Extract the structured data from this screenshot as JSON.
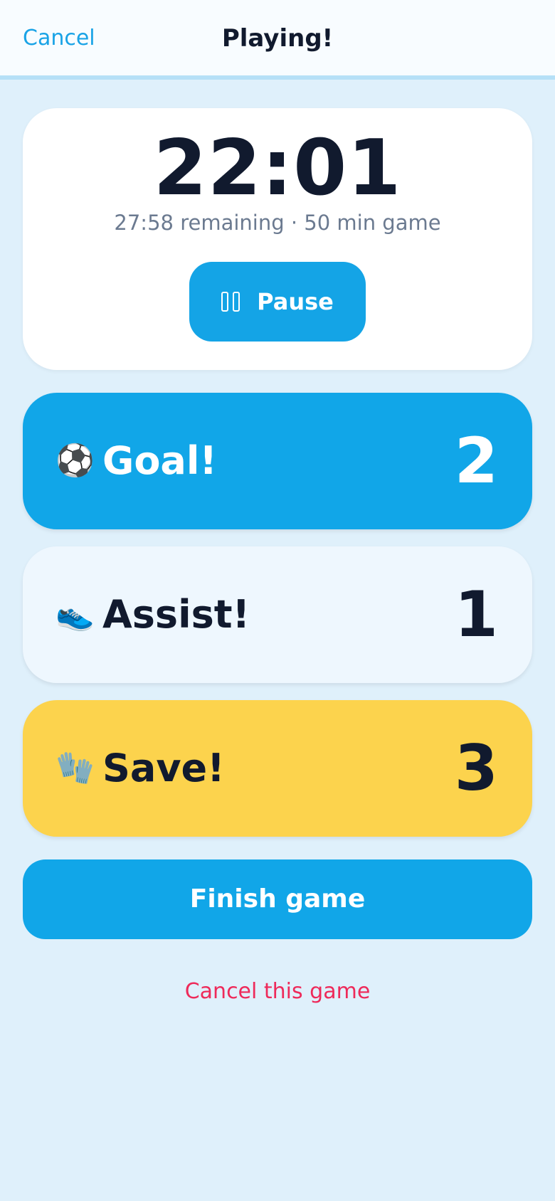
{
  "header": {
    "cancel_label": "Cancel",
    "title": "Playing!"
  },
  "timer": {
    "elapsed": "22:01",
    "subtitle": "27:58 remaining · 50 min game",
    "pause_label": "Pause"
  },
  "stats": {
    "goal": {
      "icon": "soccer-ball-icon",
      "emoji": "⚽",
      "label": "Goal!",
      "count": "2",
      "color": "#11a6e8"
    },
    "assist": {
      "icon": "sneaker-icon",
      "emoji": "👟",
      "label": "Assist!",
      "count": "1",
      "color": "#eef7fe"
    },
    "save": {
      "icon": "goalkeeper-glove-icon",
      "emoji": "🧤",
      "label": "Save!",
      "count": "3",
      "color": "#fcd34d"
    }
  },
  "actions": {
    "finish_label": "Finish game",
    "cancel_game_label": "Cancel this game"
  },
  "colors": {
    "accent": "#14a4e6",
    "danger": "#ee2a5a",
    "background": "#dff0fb"
  }
}
